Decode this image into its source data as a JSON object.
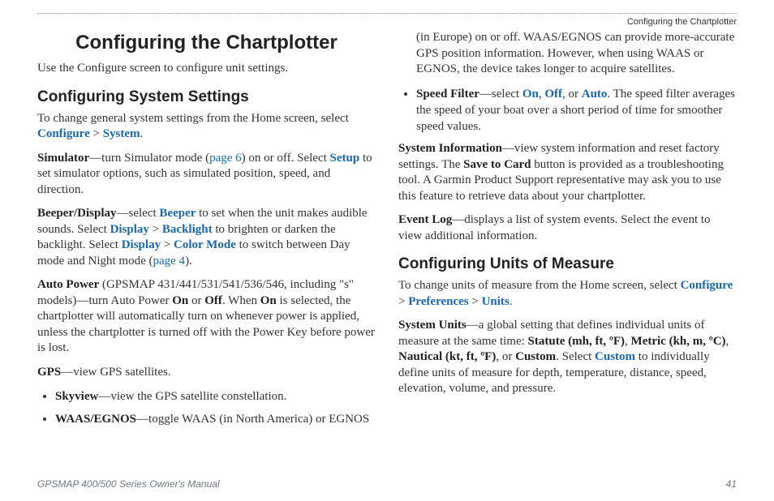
{
  "header": {
    "running": "Configuring the Chartplotter"
  },
  "chapter": {
    "title": "Configuring the Chartplotter"
  },
  "intro": "Use the Configure screen to configure unit settings.",
  "s1": {
    "heading": "Configuring System Settings",
    "lead_a": "To change general system settings from the Home screen, select ",
    "lead_link1": "Configure",
    "lead_sep": " > ",
    "lead_link2": "System",
    "lead_end": ".",
    "sim_b": "Simulator",
    "sim_a": "—turn Simulator mode (",
    "sim_page": "page 6",
    "sim_c": ") on or off. Select ",
    "sim_setup": "Setup",
    "sim_d": " to set simulator options, such as simulated position, speed, and direction.",
    "bd_b": "Beeper/Display",
    "bd_a": "—select ",
    "bd_l1": "Beeper",
    "bd_c": " to set when the unit makes audible sounds. Select ",
    "bd_l2": "Display",
    "bd_sep": " > ",
    "bd_l3": "Backlight",
    "bd_d": " to brighten or darken the backlight. Select ",
    "bd_l4": "Display",
    "bd_l5": "Color Mode",
    "bd_e": " to switch between Day mode and Night mode (",
    "bd_page": "page 4",
    "bd_f": ").",
    "ap_b": "Auto Power",
    "ap_a": " (GPSMAP 431/441/531/541/536/546, including \"s\" models)—turn Auto Power ",
    "ap_on": "On",
    "ap_or": " or ",
    "ap_off": "Off",
    "ap_b2": ". When ",
    "ap_on2": "On",
    "ap_c": " is selected, the chartplotter will automatically turn on whenever power is applied, unless the chartplotter is turned off with the Power Key before power is lost.",
    "gps_b": "GPS",
    "gps_a": "—view GPS satellites.",
    "li1_b": "Skyview",
    "li1_a": "—view the GPS satellite constellation.",
    "li2_b": "WAAS/EGNOS",
    "li2_a": "—toggle WAAS (in North America) or EGNOS"
  },
  "s1b": {
    "cont": "(in Europe) on or off. WAAS/EGNOS can provide more-accurate GPS position information. However, when using WAAS or EGNOS, the device takes longer to acquire satellites.",
    "li3_b": "Speed Filter",
    "li3_a": "—select ",
    "li3_on": "On",
    "li3_c": ", ",
    "li3_off": "Off",
    "li3_d": ", or ",
    "li3_auto": "Auto",
    "li3_e": ". The speed filter averages the speed of your boat over a short period of time for smoother speed values.",
    "si_b": "System Information",
    "si_a": "—view system information and reset factory settings. The ",
    "si_save": "Save to Card",
    "si_c": " button is provided as a troubleshooting tool. A Garmin Product Support representative may ask you to use this feature to retrieve data about your chartplotter.",
    "el_b": "Event Log",
    "el_a": "—displays a list of system events. Select the event to view additional information."
  },
  "s2": {
    "heading": "Configuring Units of Measure",
    "lead_a": "To change units of measure from the Home screen, select ",
    "l1": "Configure",
    "sep": " > ",
    "l2": "Preferences",
    "l3": "Units",
    "lead_end": ".",
    "su_b": "System Units",
    "su_a": "—a global setting that defines individual units of measure at the same time: ",
    "su_stat": "Statute (mh, ft, ºF)",
    "su_c1": ", ",
    "su_met": "Metric (kh, m, ºC)",
    "su_c2": ", ",
    "su_naut": "Nautical (kt, ft, ºF)",
    "su_c3": ", or ",
    "su_cust": "Custom",
    "su_d": ". Select ",
    "su_custl": "Custom",
    "su_e": " to individually define units of measure for depth, temperature, distance, speed, elevation, volume, and pressure."
  },
  "footer": {
    "manual": "GPSMAP 400/500 Series Owner's Manual",
    "page": "41"
  }
}
